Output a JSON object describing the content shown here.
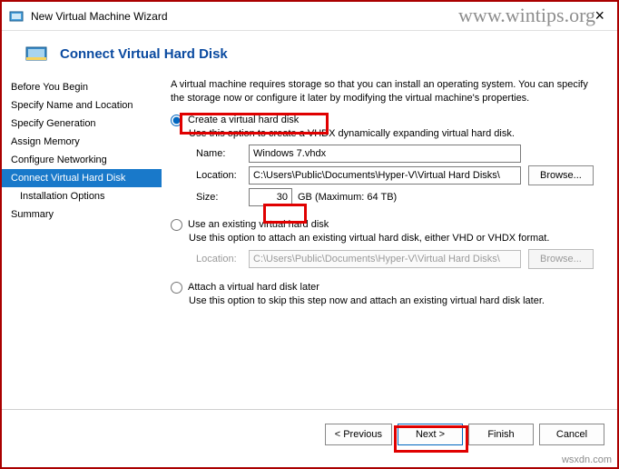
{
  "watermark": "www.wintips.org",
  "watermark2": "wsxdn.com",
  "window": {
    "title": "New Virtual Machine Wizard"
  },
  "header": {
    "title": "Connect Virtual Hard Disk"
  },
  "sidebar": {
    "items": [
      {
        "label": "Before You Begin"
      },
      {
        "label": "Specify Name and Location"
      },
      {
        "label": "Specify Generation"
      },
      {
        "label": "Assign Memory"
      },
      {
        "label": "Configure Networking"
      },
      {
        "label": "Connect Virtual Hard Disk"
      },
      {
        "label": "Installation Options"
      },
      {
        "label": "Summary"
      }
    ]
  },
  "content": {
    "description": "A virtual machine requires storage so that you can install an operating system. You can specify the storage now or configure it later by modifying the virtual machine's properties.",
    "option1": {
      "label": "Create a virtual hard disk",
      "sub": "Use this option to create a VHDX dynamically expanding virtual hard disk.",
      "fields": {
        "name_label": "Name:",
        "name_value": "Windows 7.vhdx",
        "location_label": "Location:",
        "location_value": "C:\\Users\\Public\\Documents\\Hyper-V\\Virtual Hard Disks\\",
        "browse_label": "Browse...",
        "size_label": "Size:",
        "size_value": "30",
        "size_after": "GB (Maximum: 64 TB)"
      }
    },
    "option2": {
      "label": "Use an existing virtual hard disk",
      "sub": "Use this option to attach an existing virtual hard disk, either VHD or VHDX format.",
      "fields": {
        "location_label": "Location:",
        "location_value": "C:\\Users\\Public\\Documents\\Hyper-V\\Virtual Hard Disks\\",
        "browse_label": "Browse..."
      }
    },
    "option3": {
      "label": "Attach a virtual hard disk later",
      "sub": "Use this option to skip this step now and attach an existing virtual hard disk later."
    }
  },
  "footer": {
    "previous": "< Previous",
    "next": "Next >",
    "finish": "Finish",
    "cancel": "Cancel"
  }
}
